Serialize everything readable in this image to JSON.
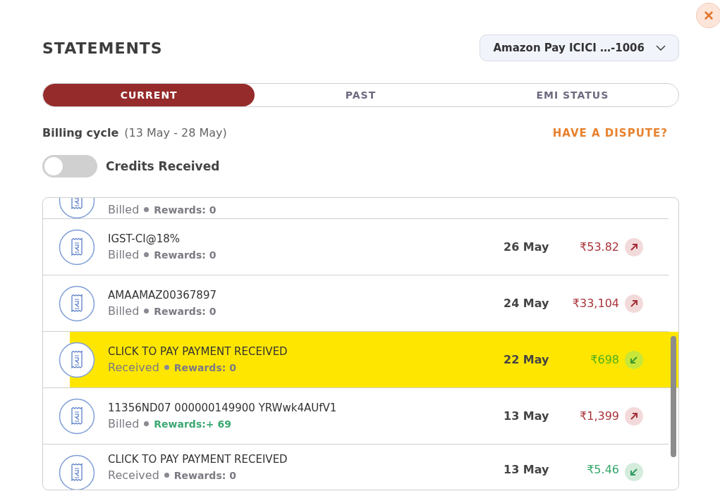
{
  "close_button": {
    "label": "×"
  },
  "title": "STATEMENTS",
  "card_selector": {
    "value": "Amazon Pay ICICI …-1006"
  },
  "tabs": [
    {
      "label": "CURRENT",
      "selected": true
    },
    {
      "label": "PAST",
      "selected": false
    },
    {
      "label": "EMI STATUS",
      "selected": false
    }
  ],
  "billing_cycle": {
    "label": "Billing cycle",
    "range": "(13 May - 28 May)"
  },
  "dispute_link": {
    "label": "HAVE A DISPUTE?"
  },
  "credits_toggle": {
    "label": "Credits Received",
    "on": false
  },
  "transactions": [
    {
      "status": "Billed",
      "rewards": "Rewards: 0",
      "rewards_earned": false,
      "highlighted": false
    },
    {
      "title": "IGST-CI@18%",
      "status": "Billed",
      "rewards": "Rewards: 0",
      "rewards_earned": false,
      "date": "26 May",
      "amount": "₹53.82",
      "kind": "debit",
      "highlighted": false
    },
    {
      "title": "AMAAMAZ00367897",
      "status": "Billed",
      "rewards": "Rewards: 0",
      "rewards_earned": false,
      "date": "24 May",
      "amount": "₹33,104",
      "kind": "debit",
      "highlighted": false
    },
    {
      "title": "CLICK TO PAY PAYMENT RECEIVED",
      "status": "Received",
      "rewards": "Rewards: 0",
      "rewards_earned": false,
      "date": "22 May",
      "amount": "₹698",
      "kind": "credit",
      "highlighted": true
    },
    {
      "title": "11356ND07 000000149900 YRWwk4AUfV1",
      "status": "Billed",
      "rewards": "Rewards:+ 69",
      "rewards_earned": true,
      "date": "13 May",
      "amount": "₹1,399",
      "kind": "debit",
      "highlighted": false
    },
    {
      "title": "CLICK TO PAY PAYMENT RECEIVED",
      "status": "Received",
      "rewards": "Rewards: 0",
      "rewards_earned": false,
      "date": "13 May",
      "amount": "₹5.46",
      "kind": "credit",
      "highlighted": false
    }
  ]
}
